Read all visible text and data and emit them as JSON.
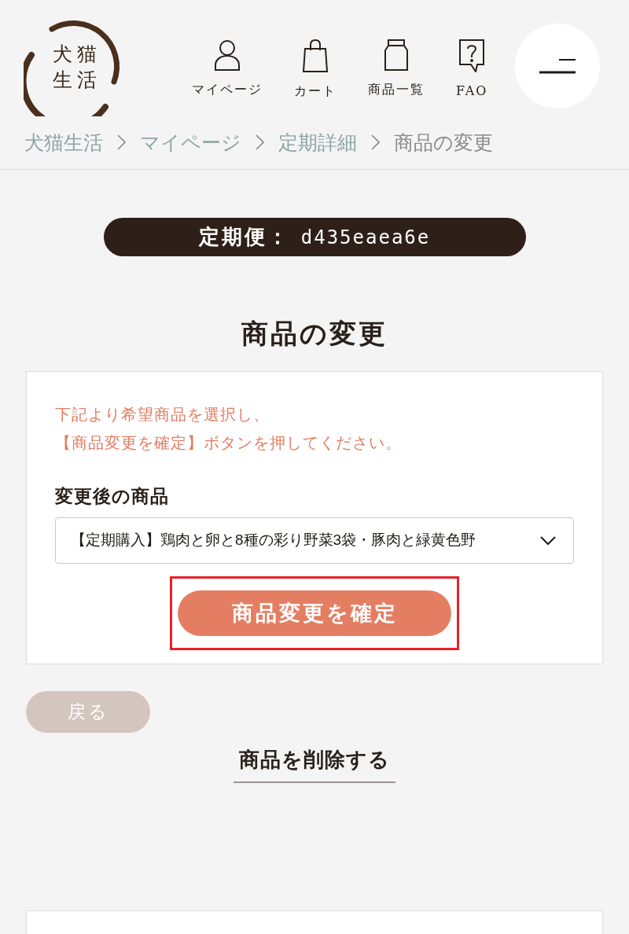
{
  "header": {
    "logo": {
      "lines": [
        "犬猫",
        "生活"
      ]
    },
    "nav": [
      {
        "kind": "mypage",
        "label": "マイページ"
      },
      {
        "kind": "cart",
        "label": "カート"
      },
      {
        "kind": "products",
        "label": "商品一覧"
      },
      {
        "kind": "faq",
        "label": "FAO"
      }
    ]
  },
  "breadcrumb": [
    {
      "label": "犬猫生活",
      "current": false
    },
    {
      "label": "マイページ",
      "current": false
    },
    {
      "label": "定期詳細",
      "current": false
    },
    {
      "label": "商品の変更",
      "current": true
    }
  ],
  "subscription": {
    "label": "定期便：",
    "id": "d435eaea6e"
  },
  "heading": "商品の変更",
  "change_form": {
    "instruction_lines": [
      "下記より希望商品を選択し、",
      "【商品変更を確定】ボタンを押してください。"
    ],
    "field_label": "変更後の商品",
    "select": {
      "value": "【定期購入】鶏肉と卵と8種の彩り野菜3袋・豚肉と緑黄色野"
    },
    "confirm_button": {
      "label": "商品変更を確定",
      "highlighted": true
    }
  },
  "back_button": {
    "label": "戻る"
  },
  "delete_link": {
    "label": "商品を削除する"
  }
}
